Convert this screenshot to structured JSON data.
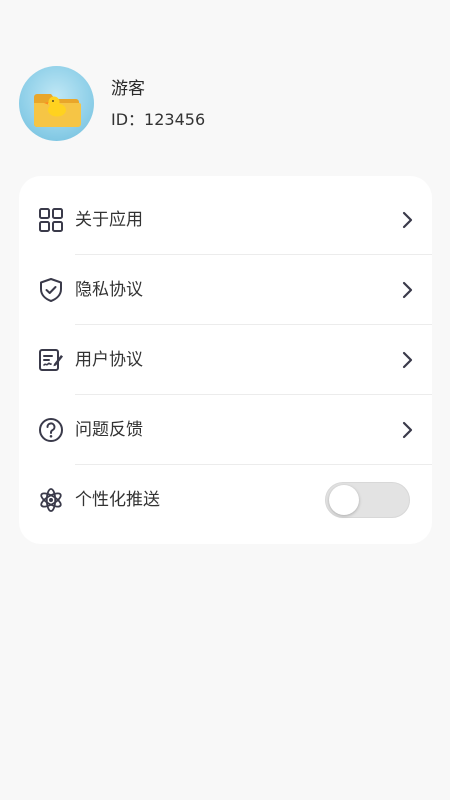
{
  "profile": {
    "name": "游客",
    "id_text": "ID：123456"
  },
  "menu": {
    "items": [
      {
        "label": "关于应用",
        "icon": "grid-icon"
      },
      {
        "label": "隐私协议",
        "icon": "shield-check-icon"
      },
      {
        "label": "用户协议",
        "icon": "document-sign-icon"
      },
      {
        "label": "问题反馈",
        "icon": "question-circle-icon"
      },
      {
        "label": "个性化推送",
        "icon": "atom-icon",
        "toggle_on": false
      }
    ]
  },
  "colors": {
    "background": "#f8f8f8",
    "card": "#ffffff",
    "icon_stroke": "#3a3a4a",
    "toggle_off": "#e3e3e3"
  }
}
